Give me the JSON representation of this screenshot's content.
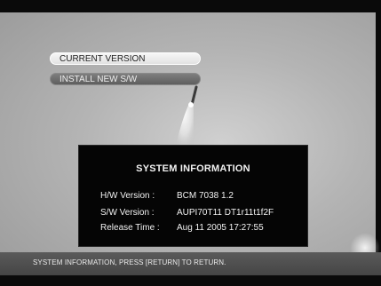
{
  "menu": {
    "items": [
      {
        "label": "CURRENT VERSION",
        "state": "selected"
      },
      {
        "label": "INSTALL NEW S/W",
        "state": "normal"
      }
    ]
  },
  "system_information": {
    "title": "SYSTEM INFORMATION",
    "hw_label": "H/W Version :",
    "hw_value": "BCM 7038 1.2",
    "sw_label": "S/W Version :",
    "sw_value": "AUPI70T11 DT1r11t1f2F",
    "release_label": "Release Time :",
    "release_value": "Aug 11 2005 17:27:55"
  },
  "status_bar": {
    "text": "SYSTEM INFORMATION, PRESS [RETURN] TO RETURN."
  },
  "colors": {
    "panel_bg": "#050505",
    "menu_selected": "#eeeeee",
    "menu_normal": "#6e6e6e",
    "status_bar": "#4f4f4f"
  }
}
